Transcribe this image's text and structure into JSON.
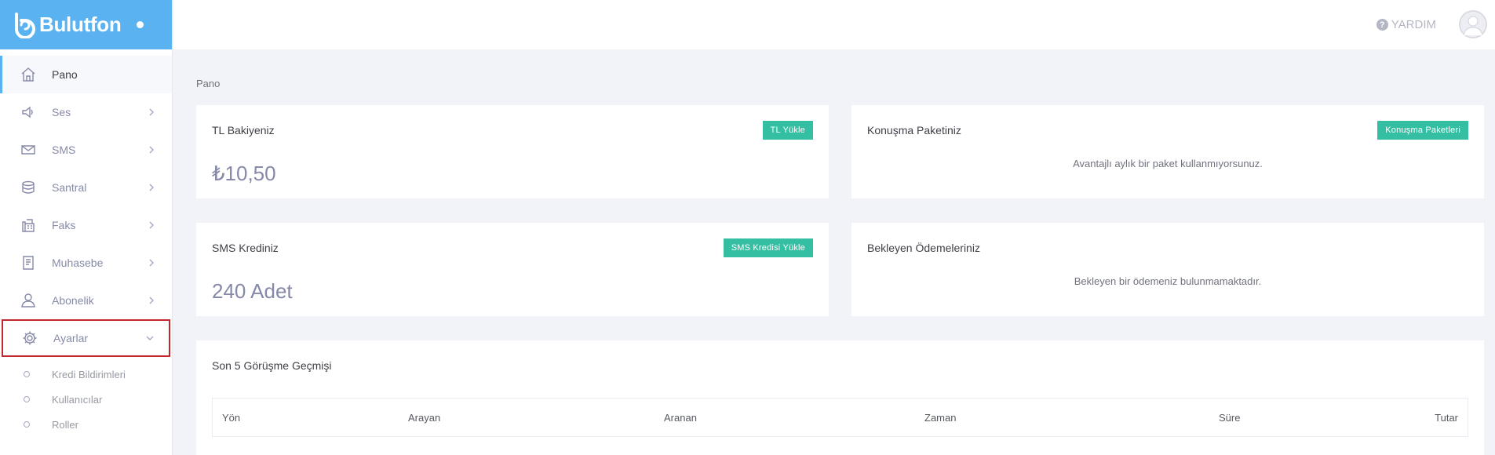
{
  "brand": {
    "name": "Bulutfon"
  },
  "header": {
    "help_label": "YARDIM"
  },
  "sidebar": {
    "items": [
      {
        "label": "Pano",
        "icon": "home-icon"
      },
      {
        "label": "Ses",
        "icon": "speaker-icon"
      },
      {
        "label": "SMS",
        "icon": "envelope-icon"
      },
      {
        "label": "Santral",
        "icon": "database-icon"
      },
      {
        "label": "Faks",
        "icon": "fax-icon"
      },
      {
        "label": "Muhasebe",
        "icon": "document-icon"
      },
      {
        "label": "Abonelik",
        "icon": "user-icon"
      },
      {
        "label": "Ayarlar",
        "icon": "gear-icon"
      }
    ],
    "submenu": [
      {
        "label": "Kredi Bildirimleri"
      },
      {
        "label": "Kullanıcılar"
      },
      {
        "label": "Roller"
      }
    ]
  },
  "main": {
    "breadcrumb": "Pano",
    "tl_card": {
      "title": "TL Bakiyeniz",
      "button": "TL Yükle",
      "value": "₺10,50"
    },
    "package_card": {
      "title": "Konuşma Paketiniz",
      "button": "Konuşma Paketleri",
      "message": "Avantajlı aylık bir paket kullanmıyorsunuz."
    },
    "sms_card": {
      "title": "SMS Krediniz",
      "button": "SMS Kredisi Yükle",
      "value": "240 Adet"
    },
    "payments_card": {
      "title": "Bekleyen Ödemeleriniz",
      "message": "Bekleyen bir ödemeniz bulunmamaktadır."
    },
    "history": {
      "title": "Son 5 Görüşme Geçmişi",
      "columns": [
        "Yön",
        "Arayan",
        "Aranan",
        "Zaman",
        "Süre",
        "Tutar"
      ]
    }
  },
  "colors": {
    "brand": "#5ab3f0",
    "button": "#34bfa3",
    "highlight": "#c1272d"
  }
}
